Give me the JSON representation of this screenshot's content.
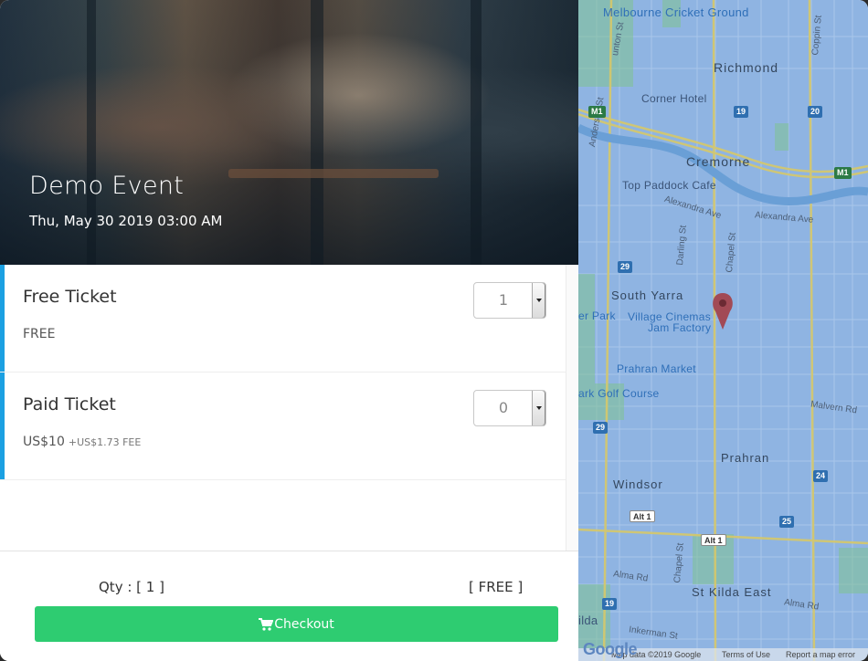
{
  "event": {
    "title": "Demo Event",
    "datetime": "Thu, May 30 2019 03:00 AM"
  },
  "tickets": [
    {
      "name": "Free Ticket",
      "price": "FREE",
      "fee": "",
      "quantity": "1"
    },
    {
      "name": "Paid Ticket",
      "price": "US$10",
      "fee": "+US$1.73 FEE",
      "quantity": "0"
    }
  ],
  "summary": {
    "qty_label": "Qty : [ 1 ]",
    "total_label": "[ FREE ]"
  },
  "checkout": {
    "label": "Checkout",
    "icon": "cart-icon",
    "color": "#2ecc71"
  },
  "colors": {
    "accent_bar": "#1ba0e2",
    "map_water": "#8fb4e2"
  },
  "map": {
    "labels": {
      "melbourne_cricket": "Melbourne Cricket Ground",
      "richmond": "Richmond",
      "corner_hotel": "Corner Hotel",
      "cremorne": "Cremorne",
      "top_paddock": "Top Paddock Cafe",
      "alexandra_ave": "Alexandra Ave",
      "alexandra_ave2": "Alexandra Ave",
      "south_yarra": "South Yarra",
      "village_cinemas": "Village Cinemas",
      "jam_factory": "Jam Factory",
      "er_park": "er Park",
      "prahran_market": "Prahran Market",
      "golf_course": "ark Golf Course",
      "malvern_rd": "Malvern Rd",
      "prahran": "Prahran",
      "windsor": "Windsor",
      "st_kilda_east": "St Kilda East",
      "alma_rd": "Alma Rd",
      "alma_rd2": "Alma Rd",
      "inkerman_st": "Inkerman St",
      "ilda": "ilda",
      "anderson_st": "Anderson St",
      "darling_st": "Darling St",
      "chapel_st": "Chapel St",
      "chapel_st2": "Chapel St",
      "coppin_st": "Coppin St",
      "punt": "unton St"
    },
    "shields": {
      "m1_a": "M1",
      "m1_b": "M1",
      "r20": "20",
      "r29a": "29",
      "r29b": "29",
      "r24": "24",
      "r25": "25",
      "alt1a": "Alt 1",
      "alt1b": "Alt 1",
      "r19": "19",
      "r19b": "19"
    },
    "footer": {
      "google": "Google",
      "map_data": "Map data ©2019 Google",
      "terms": "Terms of Use",
      "report": "Report a map error"
    }
  }
}
